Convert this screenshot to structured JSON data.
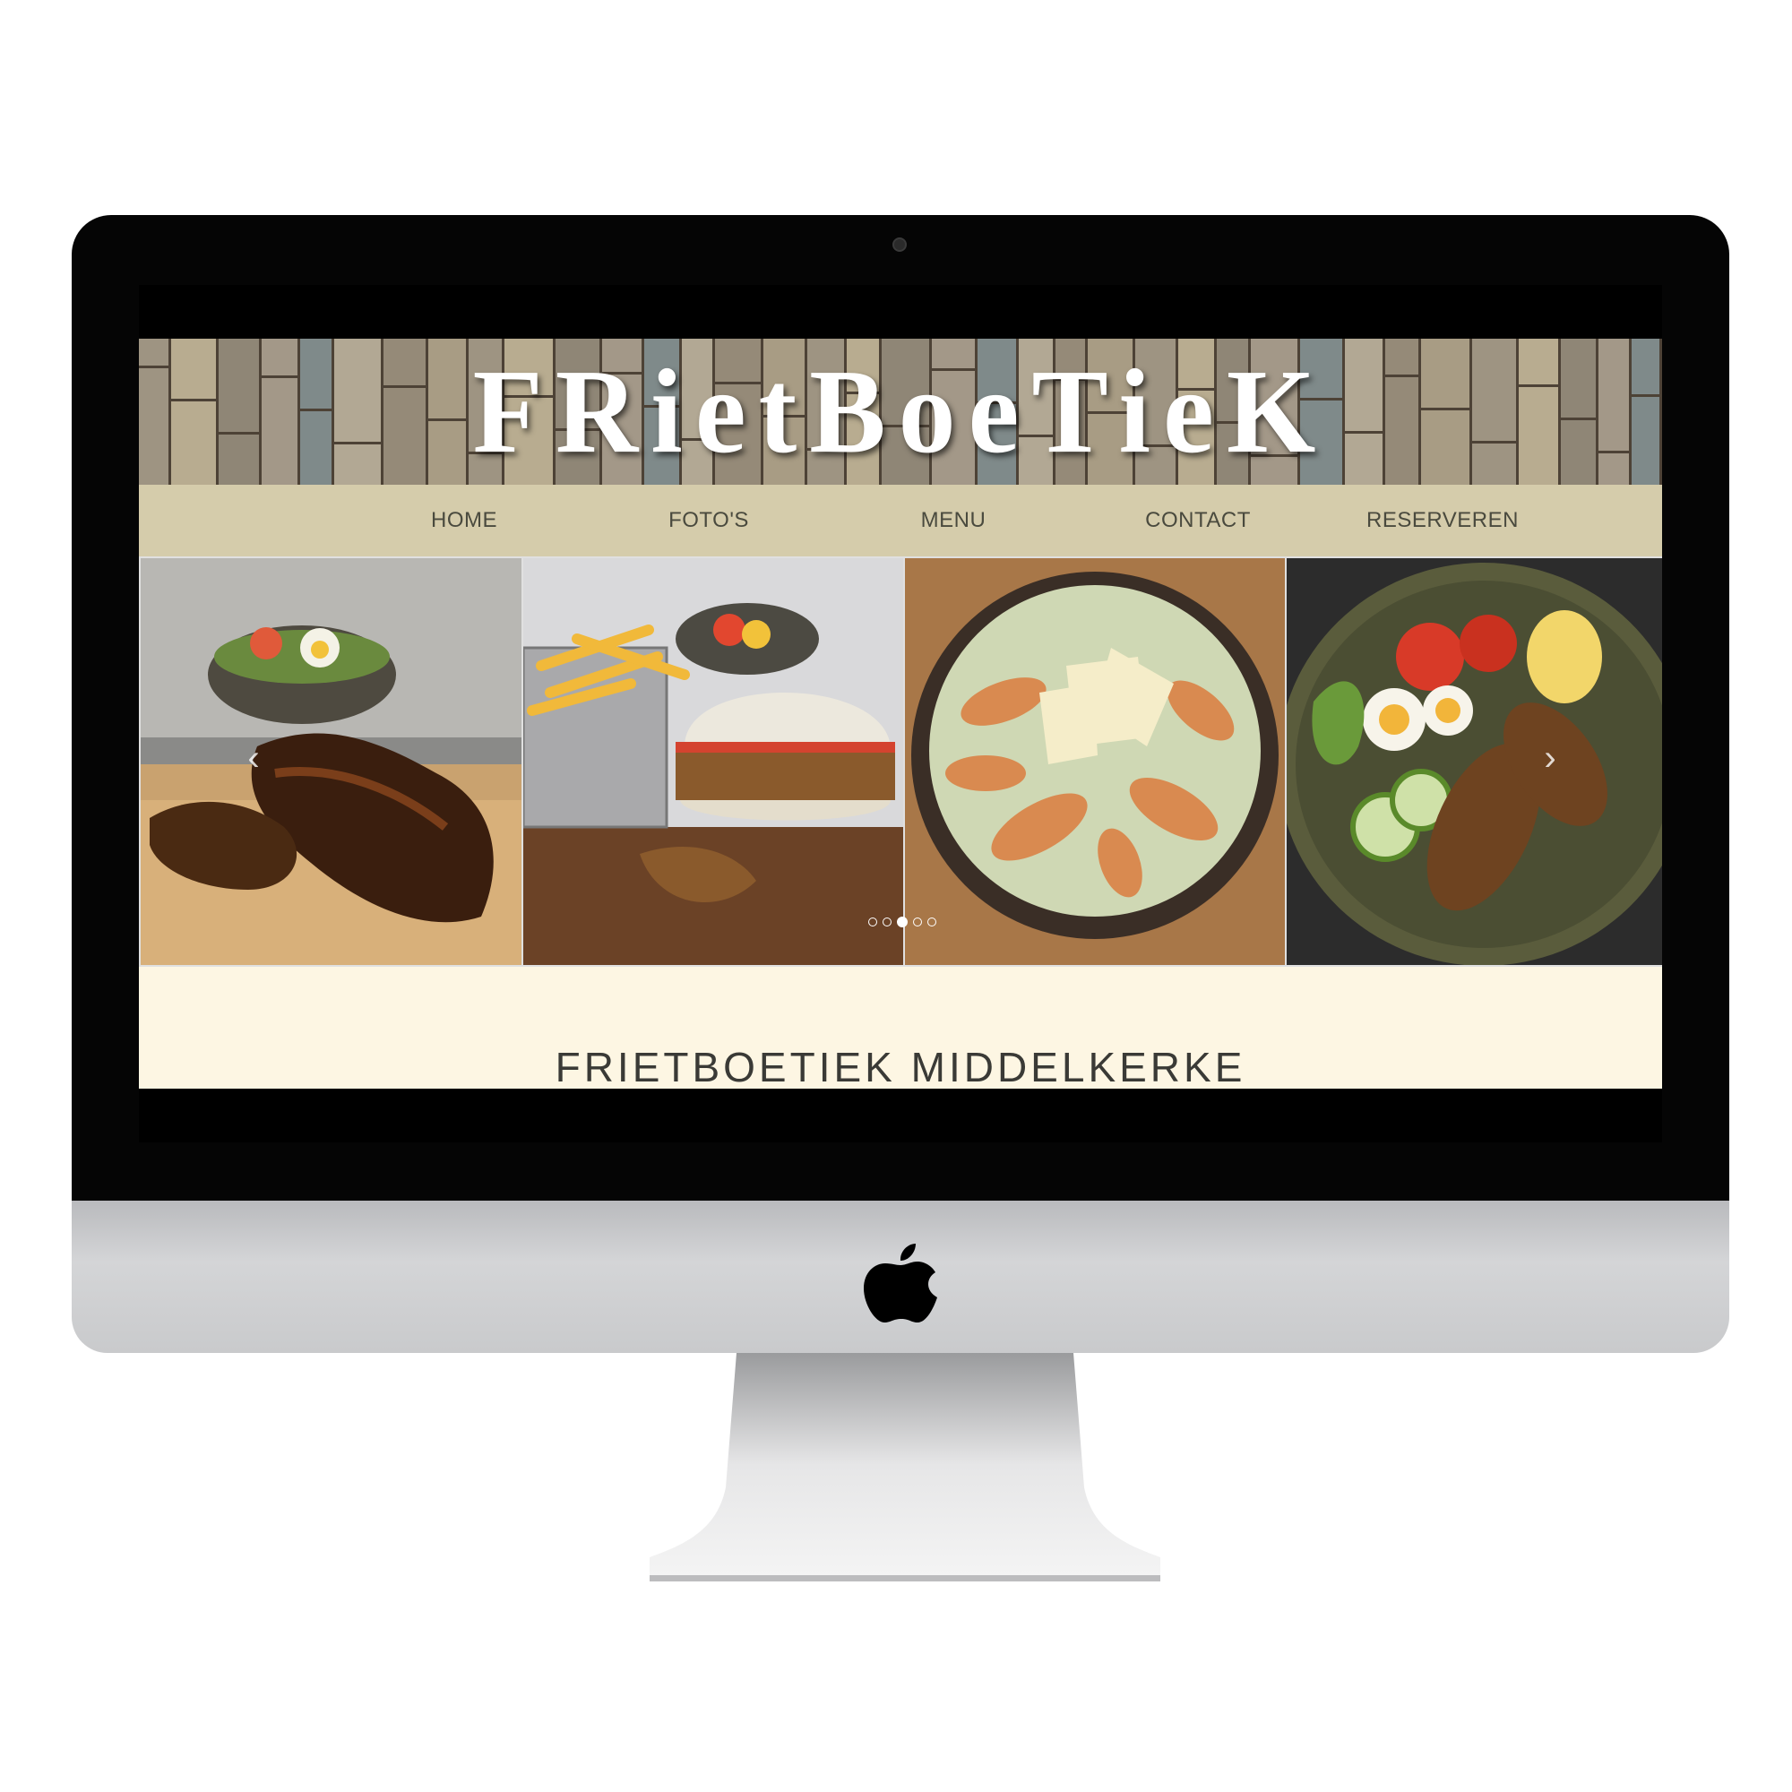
{
  "site": {
    "logo": "FRietBoeTieK",
    "heading": "FRIETBOETIEK MIDDELKERKE"
  },
  "nav": {
    "items": [
      {
        "label": "HOME"
      },
      {
        "label": "FOTO'S"
      },
      {
        "label": "MENU"
      },
      {
        "label": "CONTACT"
      },
      {
        "label": "RESERVEREN"
      }
    ]
  },
  "carousel": {
    "slides": [
      {
        "icon": "spare-ribs-photo"
      },
      {
        "icon": "burger-fries-photo"
      },
      {
        "icon": "chicken-salad-photo"
      },
      {
        "icon": "croquette-salad-photo"
      }
    ],
    "dot_count": 5,
    "active_dot": 3,
    "prev_icon": "chevron-left-icon",
    "next_icon": "chevron-right-icon"
  },
  "colors": {
    "nav_bg": "#d5ccab",
    "nav_text": "#4a4a3e",
    "content_bg": "#fdf6e3",
    "heading_text": "#3a3a36"
  }
}
